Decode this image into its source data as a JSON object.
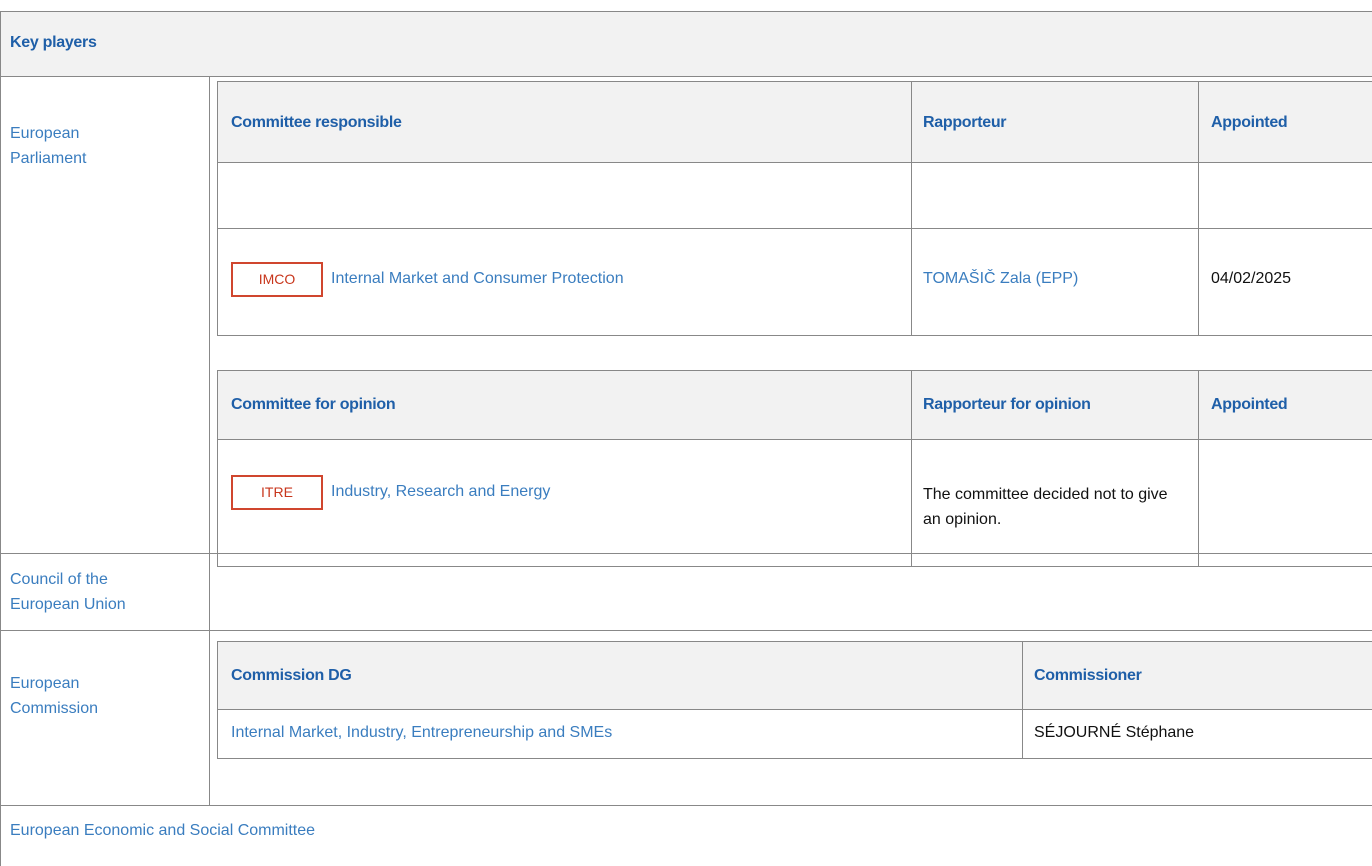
{
  "key_players": {
    "title": "Key players"
  },
  "european_parliament": {
    "label": "European Parliament",
    "responsible": {
      "headers": {
        "committee": "Committee responsible",
        "rapporteur": "Rapporteur",
        "appointed": "Appointed"
      },
      "row": {
        "code": "IMCO",
        "name": "Internal Market and Consumer Protection",
        "rapporteur": "TOMAŠIČ Zala (EPP)",
        "appointed": "04/02/2025"
      }
    },
    "opinion": {
      "headers": {
        "committee": "Committee for opinion",
        "rapporteur": "Rapporteur for opinion",
        "appointed": "Appointed"
      },
      "row": {
        "code": "ITRE",
        "name": "Industry, Research and Energy",
        "rapporteur": "The committee decided not to give an opinion.",
        "appointed": ""
      }
    }
  },
  "council": {
    "label": "Council of the European Union"
  },
  "commission": {
    "label": "European Commission",
    "headers": {
      "dg": "Commission DG",
      "commissioner": "Commissioner"
    },
    "row": {
      "dg": "Internal Market, Industry, Entrepreneurship and SMEs",
      "commissioner": "SÉJOURNÉ Stéphane"
    }
  },
  "eesc": {
    "label": "European Economic and Social Committee"
  }
}
